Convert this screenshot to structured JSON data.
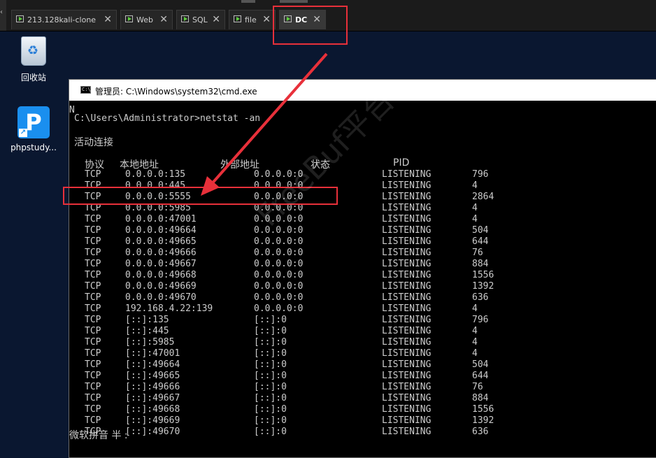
{
  "tabs": [
    {
      "label": "213.128kali-clone"
    },
    {
      "label": "Web"
    },
    {
      "label": "SQL"
    },
    {
      "label": "file"
    },
    {
      "label": "DC"
    }
  ],
  "desktop": {
    "recycle_label": "回收站",
    "php_label": "phpstudy...",
    "partial_N": "N"
  },
  "window": {
    "title": "管理员: C:\\Windows\\system32\\cmd.exe",
    "icon_text": "C:\\"
  },
  "console": {
    "prompt": "C:\\Users\\Administrator>netstat -an",
    "section_title": "活动连接",
    "headers": {
      "proto": "协议",
      "local": "本地地址",
      "foreign": "外部地址",
      "state": "状态",
      "pid": "PID"
    },
    "rows": [
      {
        "proto": "TCP",
        "local": "0.0.0.0:135",
        "foreign": "0.0.0.0:0",
        "state": "LISTENING",
        "pid": "796"
      },
      {
        "proto": "TCP",
        "local": "0.0.0.0:445",
        "foreign": "0.0.0.0:0",
        "state": "LISTENING",
        "pid": "4"
      },
      {
        "proto": "TCP",
        "local": "0.0.0.0:5555",
        "foreign": "0.0.0.0:0",
        "state": "LISTENING",
        "pid": "2864"
      },
      {
        "proto": "TCP",
        "local": "0.0.0.0:5985",
        "foreign": "0.0.0.0:0",
        "state": "LISTENING",
        "pid": "4"
      },
      {
        "proto": "TCP",
        "local": "0.0.0.0:47001",
        "foreign": "0.0.0.0:0",
        "state": "LISTENING",
        "pid": "4"
      },
      {
        "proto": "TCP",
        "local": "0.0.0.0:49664",
        "foreign": "0.0.0.0:0",
        "state": "LISTENING",
        "pid": "504"
      },
      {
        "proto": "TCP",
        "local": "0.0.0.0:49665",
        "foreign": "0.0.0.0:0",
        "state": "LISTENING",
        "pid": "644"
      },
      {
        "proto": "TCP",
        "local": "0.0.0.0:49666",
        "foreign": "0.0.0.0:0",
        "state": "LISTENING",
        "pid": "76"
      },
      {
        "proto": "TCP",
        "local": "0.0.0.0:49667",
        "foreign": "0.0.0.0:0",
        "state": "LISTENING",
        "pid": "884"
      },
      {
        "proto": "TCP",
        "local": "0.0.0.0:49668",
        "foreign": "0.0.0.0:0",
        "state": "LISTENING",
        "pid": "1556"
      },
      {
        "proto": "TCP",
        "local": "0.0.0.0:49669",
        "foreign": "0.0.0.0:0",
        "state": "LISTENING",
        "pid": "1392"
      },
      {
        "proto": "TCP",
        "local": "0.0.0.0:49670",
        "foreign": "0.0.0.0:0",
        "state": "LISTENING",
        "pid": "636"
      },
      {
        "proto": "TCP",
        "local": "192.168.4.22:139",
        "foreign": "0.0.0.0:0",
        "state": "LISTENING",
        "pid": "4"
      },
      {
        "proto": "TCP",
        "local": "[::]:135",
        "foreign": "[::]:0",
        "state": "LISTENING",
        "pid": "796"
      },
      {
        "proto": "TCP",
        "local": "[::]:445",
        "foreign": "[::]:0",
        "state": "LISTENING",
        "pid": "4"
      },
      {
        "proto": "TCP",
        "local": "[::]:5985",
        "foreign": "[::]:0",
        "state": "LISTENING",
        "pid": "4"
      },
      {
        "proto": "TCP",
        "local": "[::]:47001",
        "foreign": "[::]:0",
        "state": "LISTENING",
        "pid": "4"
      },
      {
        "proto": "TCP",
        "local": "[::]:49664",
        "foreign": "[::]:0",
        "state": "LISTENING",
        "pid": "504"
      },
      {
        "proto": "TCP",
        "local": "[::]:49665",
        "foreign": "[::]:0",
        "state": "LISTENING",
        "pid": "644"
      },
      {
        "proto": "TCP",
        "local": "[::]:49666",
        "foreign": "[::]:0",
        "state": "LISTENING",
        "pid": "76"
      },
      {
        "proto": "TCP",
        "local": "[::]:49667",
        "foreign": "[::]:0",
        "state": "LISTENING",
        "pid": "884"
      },
      {
        "proto": "TCP",
        "local": "[::]:49668",
        "foreign": "[::]:0",
        "state": "LISTENING",
        "pid": "1556"
      },
      {
        "proto": "TCP",
        "local": "[::]:49669",
        "foreign": "[::]:0",
        "state": "LISTENING",
        "pid": "1392"
      },
      {
        "proto": "TCP",
        "local": "[::]:49670",
        "foreign": "[::]:0",
        "state": "LISTENING",
        "pid": "636"
      }
    ],
    "partial_bottom": "微软拼音 半 :"
  },
  "watermark": "FreeBuf平台",
  "colors": {
    "highlight": "#e8303a",
    "console_text": "#cccccc",
    "active_tab_border": "#e8303a"
  }
}
